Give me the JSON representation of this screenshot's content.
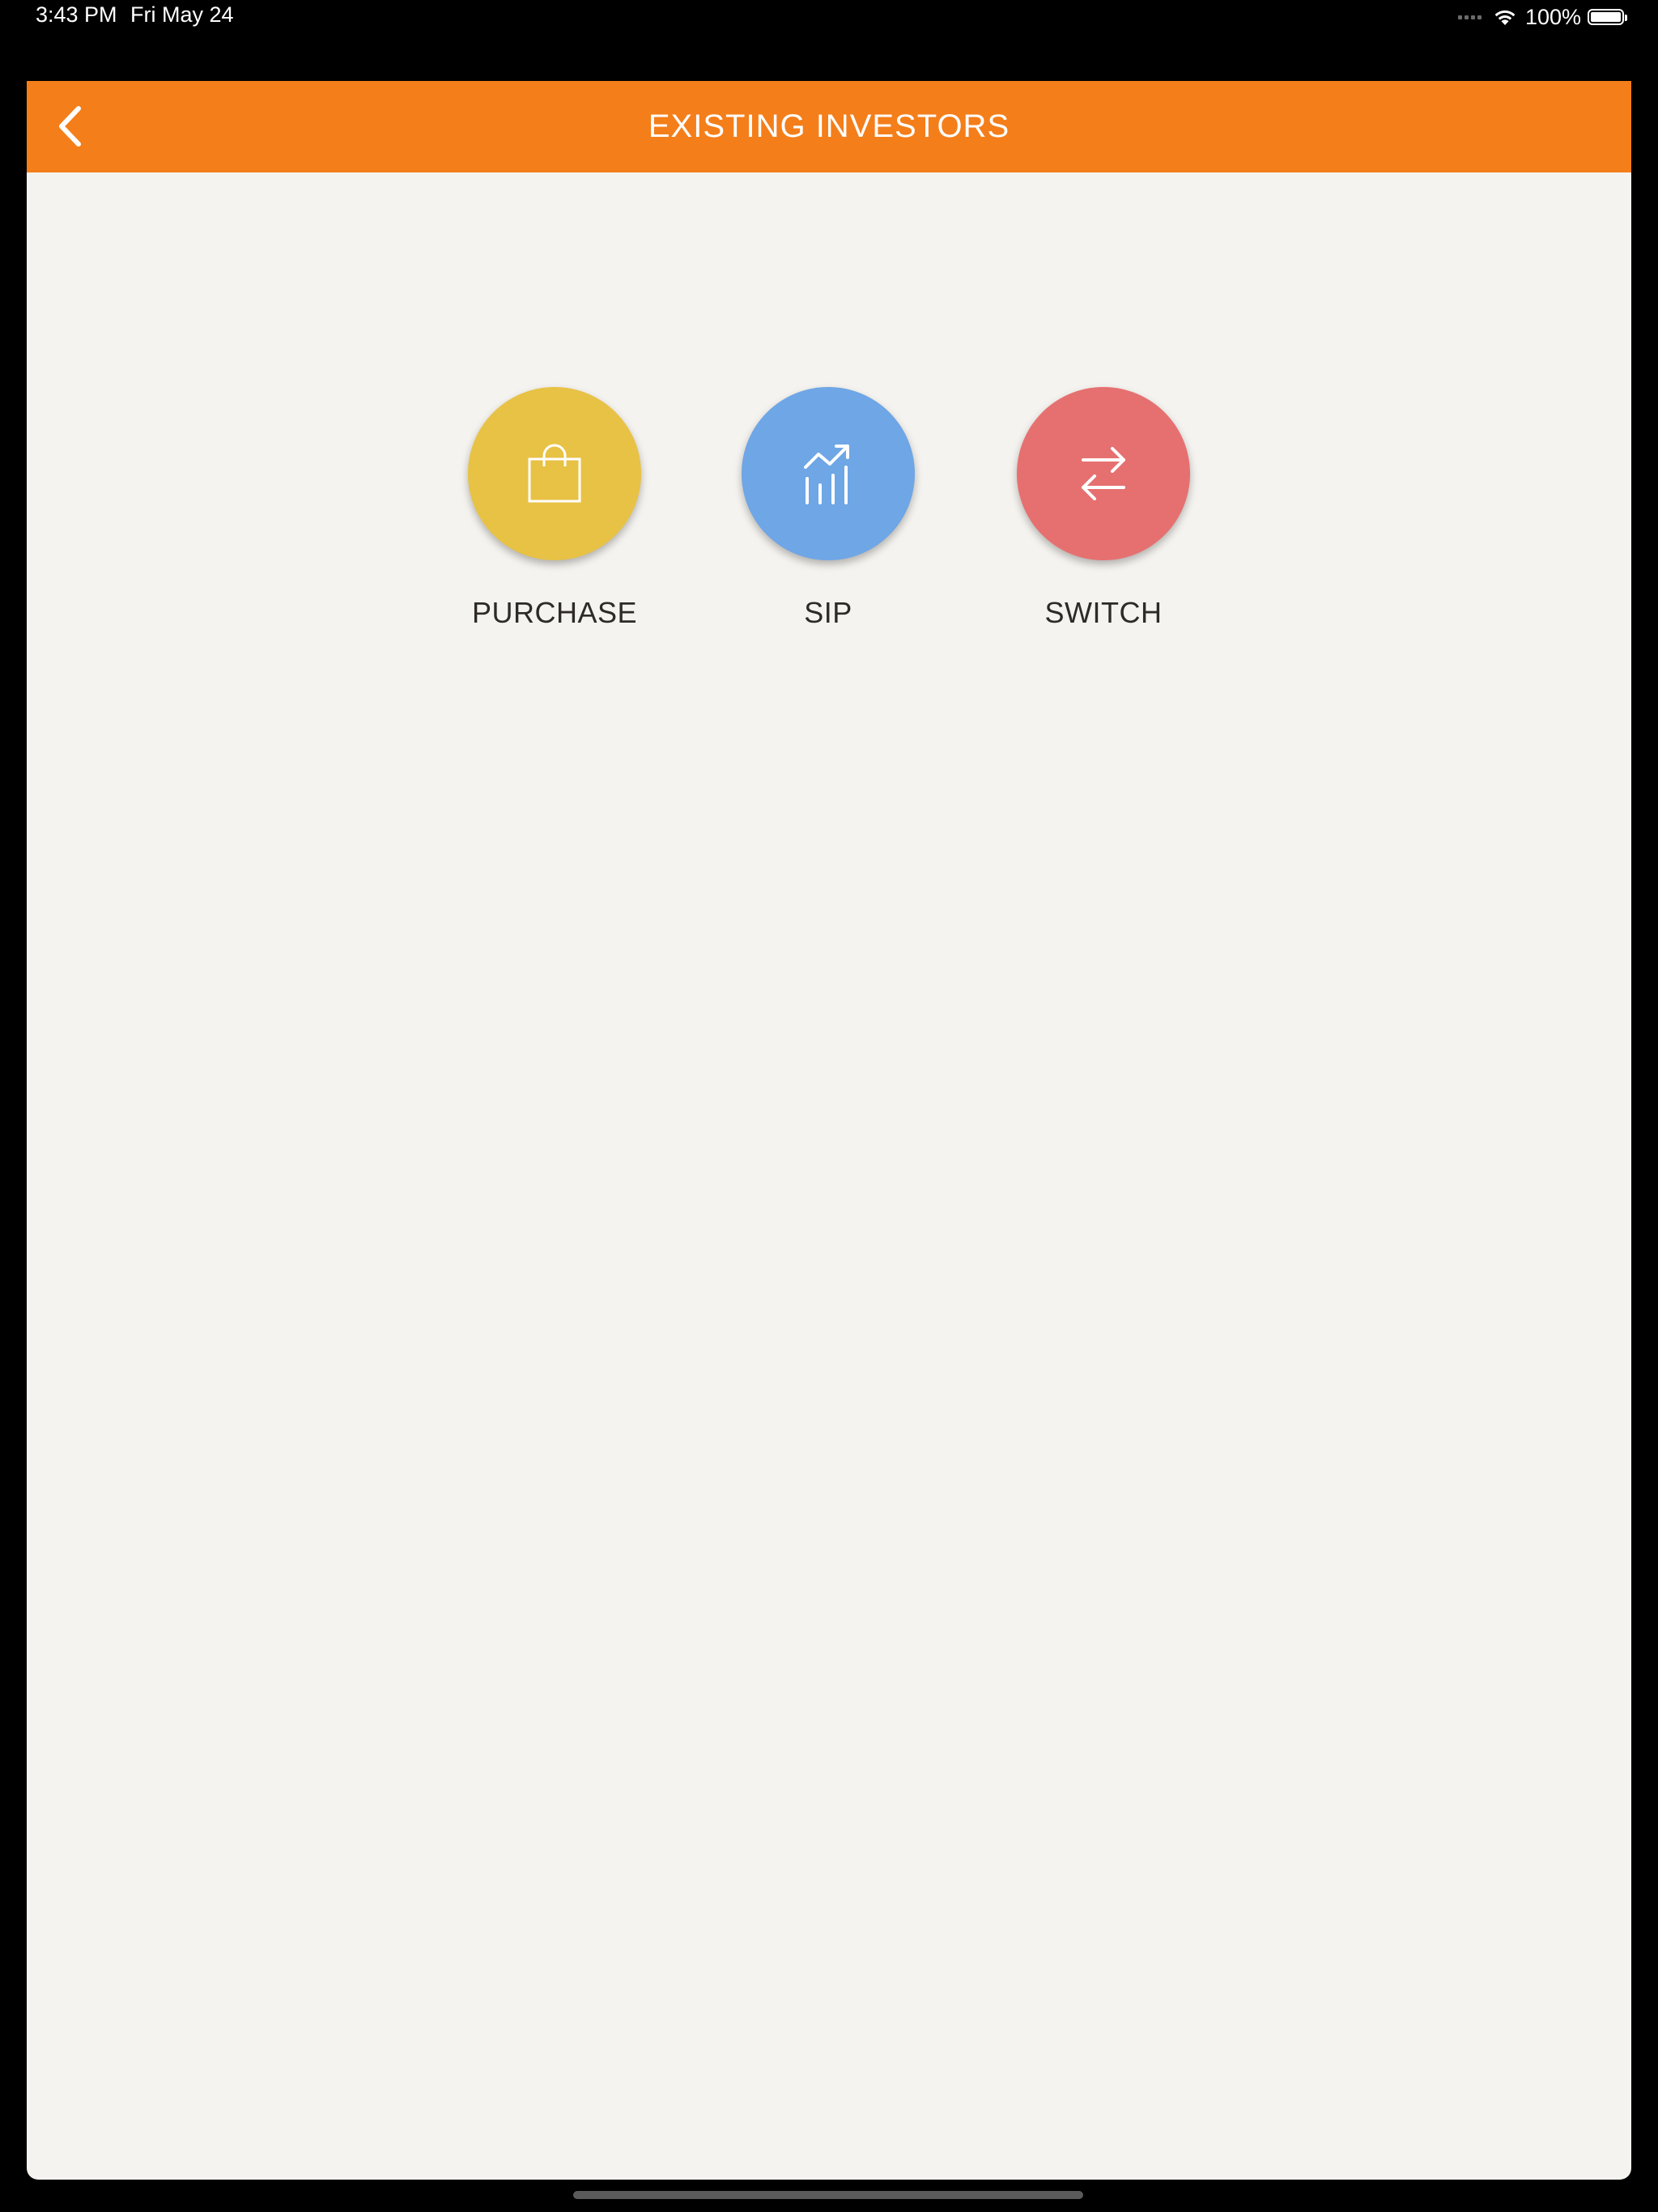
{
  "status_bar": {
    "time": "3:43 PM",
    "date": "Fri May 24",
    "battery": "100%",
    "battery_level": 1.0
  },
  "nav": {
    "title": "EXISTING INVESTORS",
    "back_icon": "chevron-left-icon"
  },
  "actions": [
    {
      "label": "PURCHASE",
      "icon": "shopping-bag-icon",
      "color": "#e8c245"
    },
    {
      "label": "SIP",
      "icon": "growth-chart-icon",
      "color": "#6ea6e6"
    },
    {
      "label": "SWITCH",
      "icon": "swap-arrows-icon",
      "color": "#e67070"
    }
  ],
  "colors": {
    "nav_bar": "#f47e1a",
    "background": "#f5f3ef",
    "label_text": "#2e2a26"
  }
}
